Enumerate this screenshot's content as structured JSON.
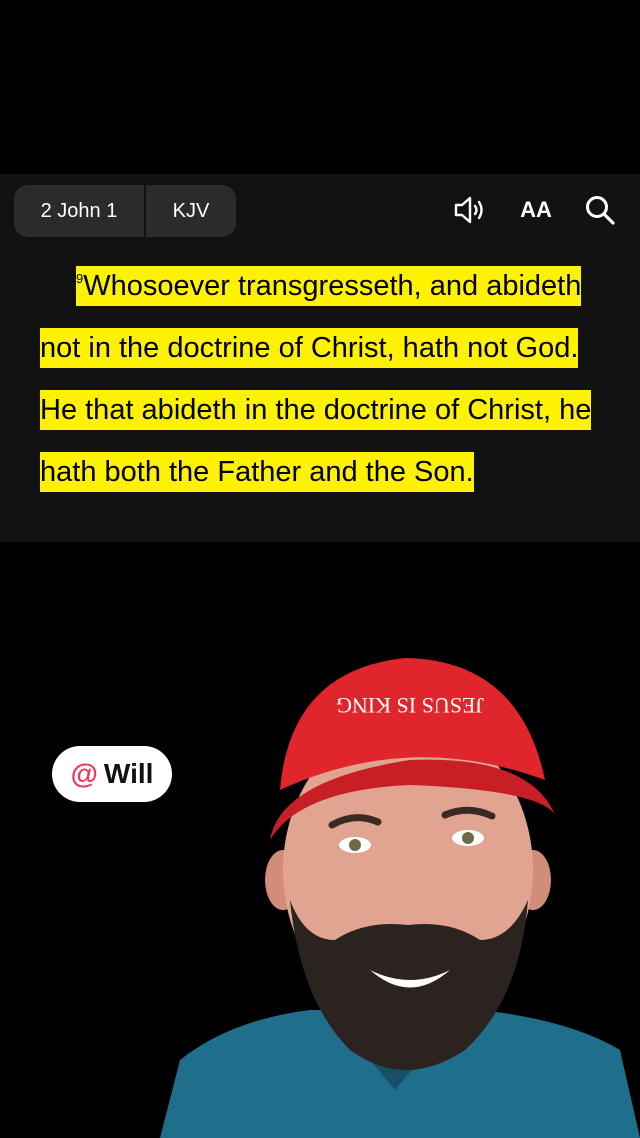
{
  "reader": {
    "book_chapter": "2 John 1",
    "version": "KJV",
    "font_label": "AA"
  },
  "verse": {
    "number": "9",
    "text": "Whosoever transgresseth, and abideth not in the doctrine of Christ, hath not God. He that abideth in the doctrine of Christ, he hath both the Father and the Son."
  },
  "mention": {
    "at": "@",
    "name": "Will"
  },
  "icons": [
    "speaker-icon",
    "font-size-icon",
    "search-icon"
  ],
  "colors": {
    "highlight": "#fff200",
    "bar": "#121212",
    "mention_at": "#f0365a",
    "cap": "#e0262c"
  },
  "person": {
    "cap_text": "JESUS IS KING"
  }
}
